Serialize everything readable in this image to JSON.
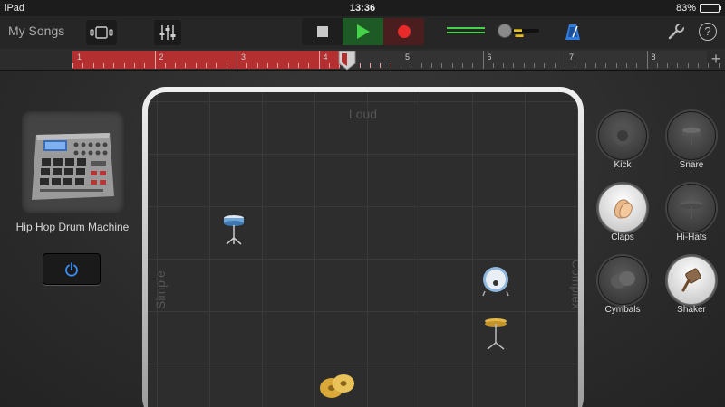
{
  "status_bar": {
    "device": "iPad",
    "time": "13:36",
    "battery": "83%",
    "battery_level": 0.83
  },
  "control_bar": {
    "back_label": "My Songs",
    "icons": [
      "browser-icon",
      "mixer-icon",
      "stop-icon",
      "play-icon",
      "record-icon",
      "metronome-icon",
      "wrench-icon",
      "help-icon"
    ],
    "help_label": "?",
    "accent_colors": {
      "play": "#1e5a25",
      "record": "#e82a2a",
      "meter": "#47d04a",
      "metronome": "#2f7de0"
    }
  },
  "ruler": {
    "bars": [
      "1",
      "2",
      "3",
      "4",
      "5",
      "6",
      "7",
      "8"
    ],
    "cycle_end_bar": 4,
    "add_label": "+"
  },
  "instrument": {
    "name": "Hip Hop Drum Machine",
    "icon": "drum-machine-icon",
    "power_icon": "power-icon"
  },
  "pad": {
    "top_label": "Loud",
    "left_label": "Simple",
    "right_label": "Complex",
    "placed_icons": [
      "snare-drum-icon",
      "kick-drum-icon",
      "hi-hat-icon",
      "cymbals-icon"
    ]
  },
  "drum_buttons": [
    {
      "label": "Kick",
      "icon": "kick-icon",
      "active": false
    },
    {
      "label": "Snare",
      "icon": "snare-icon",
      "active": false
    },
    {
      "label": "Claps",
      "icon": "claps-icon",
      "active": true
    },
    {
      "label": "Hi-Hats",
      "icon": "hi-hats-icon",
      "active": false
    },
    {
      "label": "Cymbals",
      "icon": "cymbals-icon",
      "active": false
    },
    {
      "label": "Shaker",
      "icon": "shaker-icon",
      "active": true
    }
  ]
}
